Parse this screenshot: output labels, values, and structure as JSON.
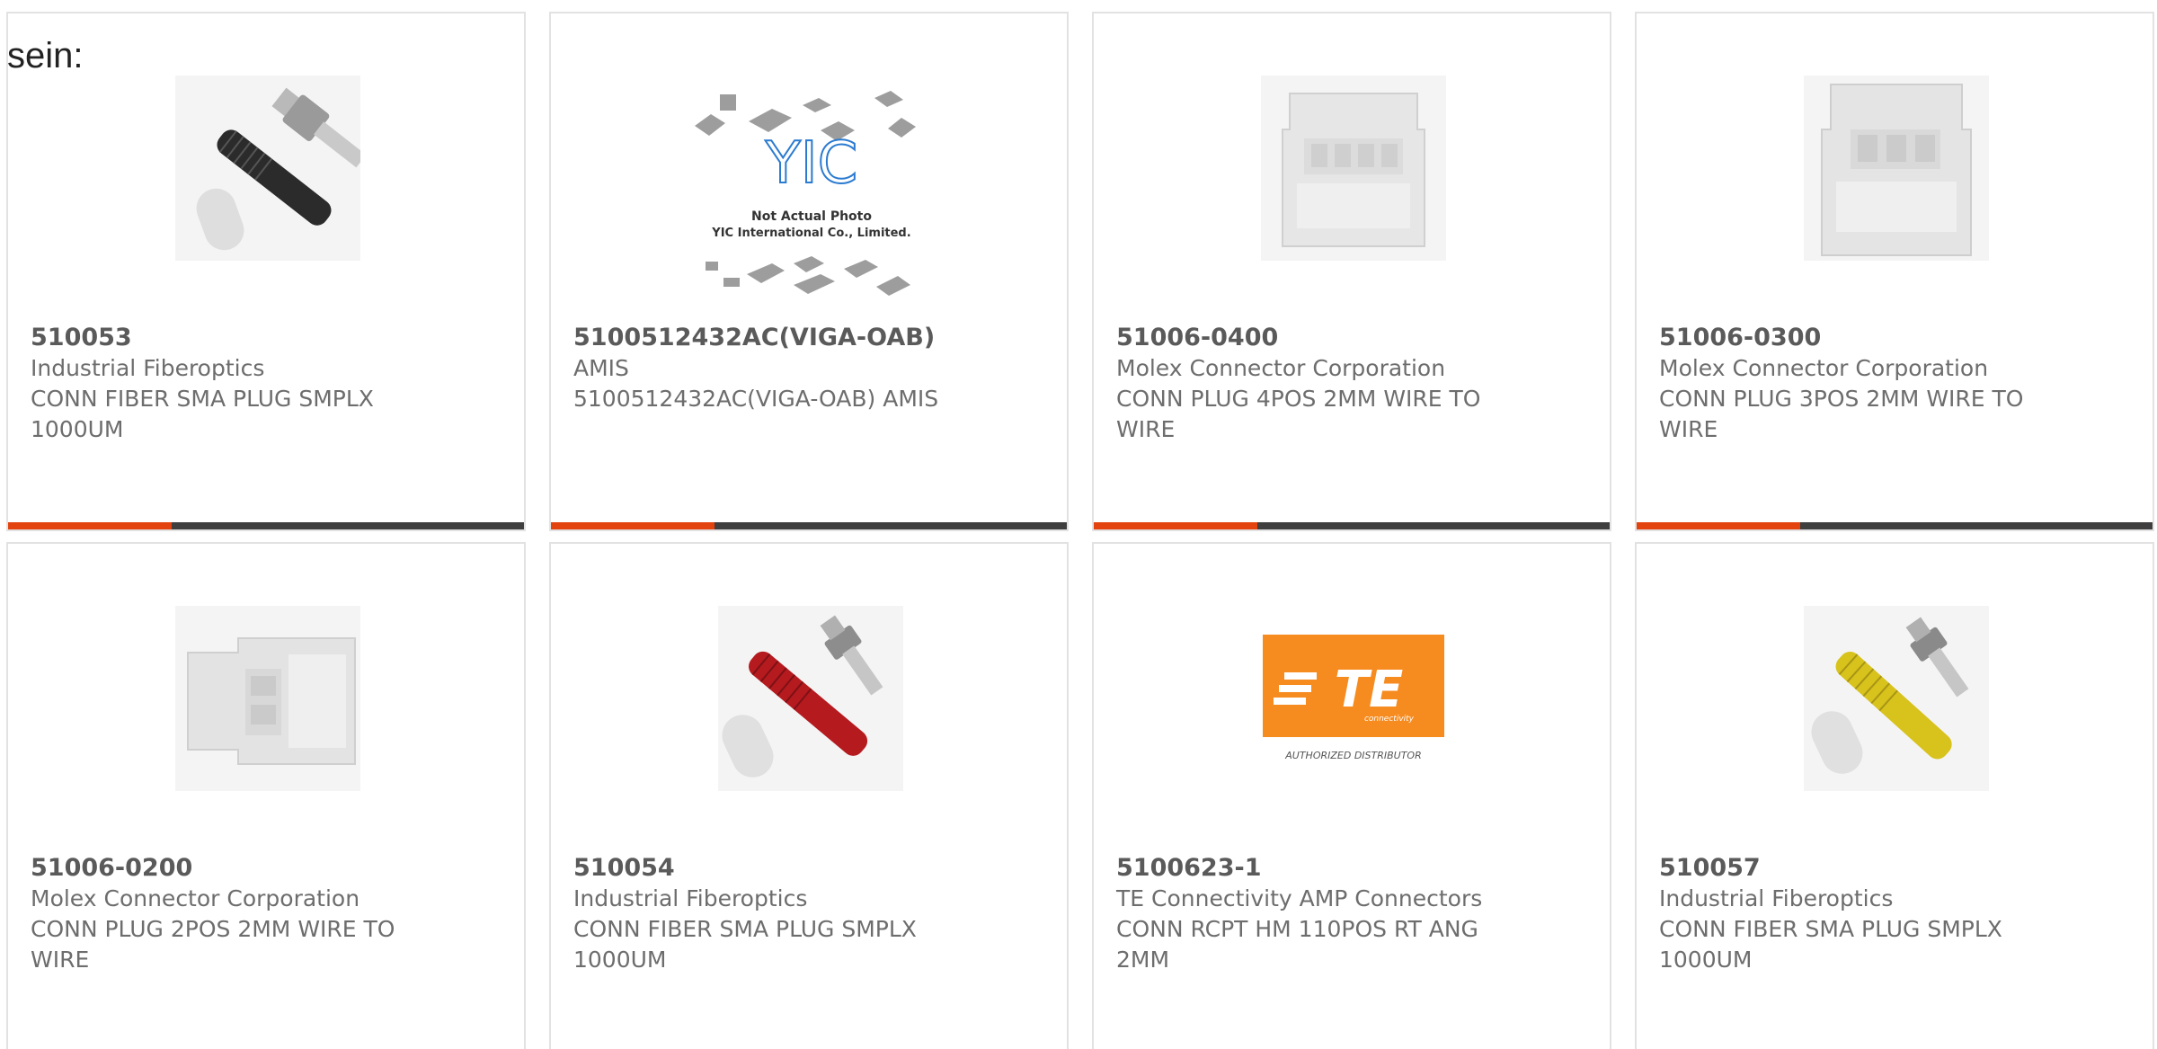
{
  "intro_text": "sein:",
  "colors": {
    "accent": "#e2430f",
    "bar": "#3f3f3f",
    "border": "#e2e2e2",
    "text": "#6d6d6d",
    "te_orange": "#f68b1f"
  },
  "products": [
    {
      "part_number": "510053",
      "manufacturer": "Industrial Fiberoptics",
      "description": "CONN FIBER SMA PLUG SMPLX 1000UM",
      "image": "fiber-sma-plug-black"
    },
    {
      "part_number": "5100512432AC(VIGA-OAB)",
      "manufacturer": "AMIS",
      "description": "5100512432AC(VIGA-OAB) AMIS",
      "image": "yic-not-actual-photo",
      "image_text": {
        "logo": "YIC",
        "line1": "Not Actual Photo",
        "line2": "YIC International Co., Limited."
      }
    },
    {
      "part_number": "51006-0400",
      "manufacturer": "Molex Connector Corporation",
      "description": "CONN PLUG 4POS 2MM WIRE TO WIRE",
      "image": "molex-plug-4pos"
    },
    {
      "part_number": "51006-0300",
      "manufacturer": "Molex Connector Corporation",
      "description": "CONN PLUG 3POS 2MM WIRE TO WIRE",
      "image": "molex-plug-3pos"
    },
    {
      "part_number": "51006-0200",
      "manufacturer": "Molex Connector Corporation",
      "description": "CONN PLUG 2POS 2MM WIRE TO WIRE",
      "image": "molex-plug-2pos"
    },
    {
      "part_number": "510054",
      "manufacturer": "Industrial Fiberoptics",
      "description": "CONN FIBER SMA PLUG SMPLX 1000UM",
      "image": "fiber-sma-plug-red"
    },
    {
      "part_number": "5100623-1",
      "manufacturer": "TE Connectivity AMP Connectors",
      "description": "CONN RCPT HM 110POS RT ANG 2MM",
      "image": "te-connectivity-logo",
      "image_text": {
        "logo": "TE",
        "sub": "connectivity",
        "caption": "AUTHORIZED DISTRIBUTOR"
      }
    },
    {
      "part_number": "510057",
      "manufacturer": "Industrial Fiberoptics",
      "description": "CONN FIBER SMA PLUG SMPLX 1000UM",
      "image": "fiber-sma-plug-yellow"
    }
  ]
}
